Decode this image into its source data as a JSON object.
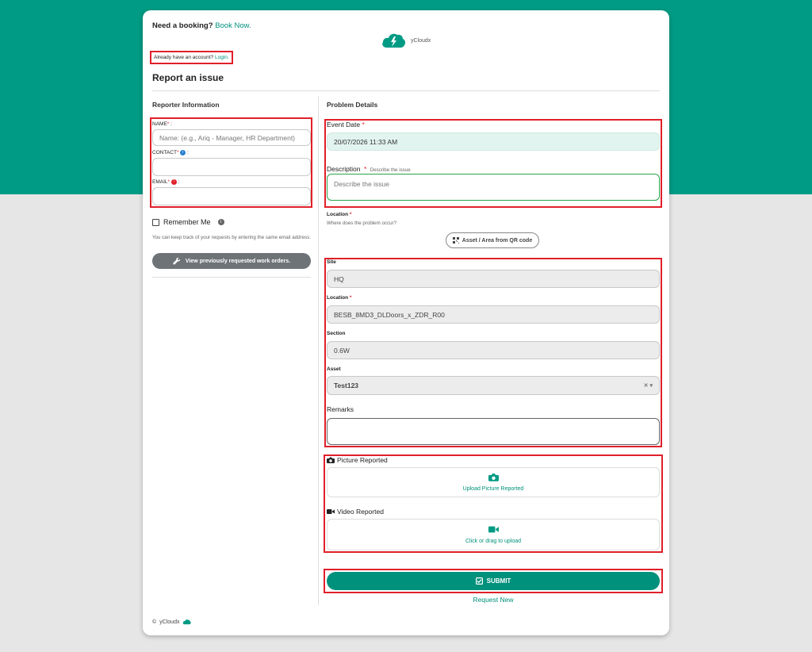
{
  "header": {
    "need_booking": "Need a booking?",
    "book_now": "Book Now.",
    "brand": "yCloudx",
    "already_account": "Already have an account?",
    "login": "Login.",
    "title": "Report an issue"
  },
  "reporter": {
    "section_title": "Reporter Information",
    "name_label": "NAME",
    "name_placeholder": "Name: (e.g., Ariq - Manager, HR Department)",
    "contact_label": "CONTACT",
    "email_label": "EMAIL",
    "required_mark": "*",
    "colon": ":",
    "remember_me": "Remember Me",
    "help_text": "You can keep track of your requests by entering the same email address.",
    "view_button": "View previously requested work orders."
  },
  "problem": {
    "section_title": "Problem Details",
    "event_date_label": "Event Date",
    "event_date_value": "20/07/2026 11:33 AM",
    "description_label": "Description",
    "description_hint": "Describe the issue",
    "description_placeholder": "Describe the issue",
    "location_label": "Location",
    "location_hint": "Where does the problem occur?",
    "qr_button": "Asset / Area from QR code",
    "site_label": "Site",
    "site_value": "HQ",
    "location2_label": "Location",
    "location2_value": "BESB_8MD3_DLDoors_x_ZDR_R00",
    "section_label": "Section",
    "section_value": "0.6W",
    "asset_label": "Asset",
    "asset_value": "Test123",
    "remarks_label": "Remarks",
    "picture_label": "Picture Reported",
    "picture_upload": "Upload Picture Reported",
    "video_label": "Video Reported",
    "video_upload": "Click or drag to upload",
    "submit": "SUBMIT",
    "request_new": "Request New"
  },
  "footer": {
    "copyright": "©",
    "brand": "yCloudx"
  },
  "colors": {
    "brand_teal": "#009b84",
    "highlight_red": "#e0202a"
  }
}
